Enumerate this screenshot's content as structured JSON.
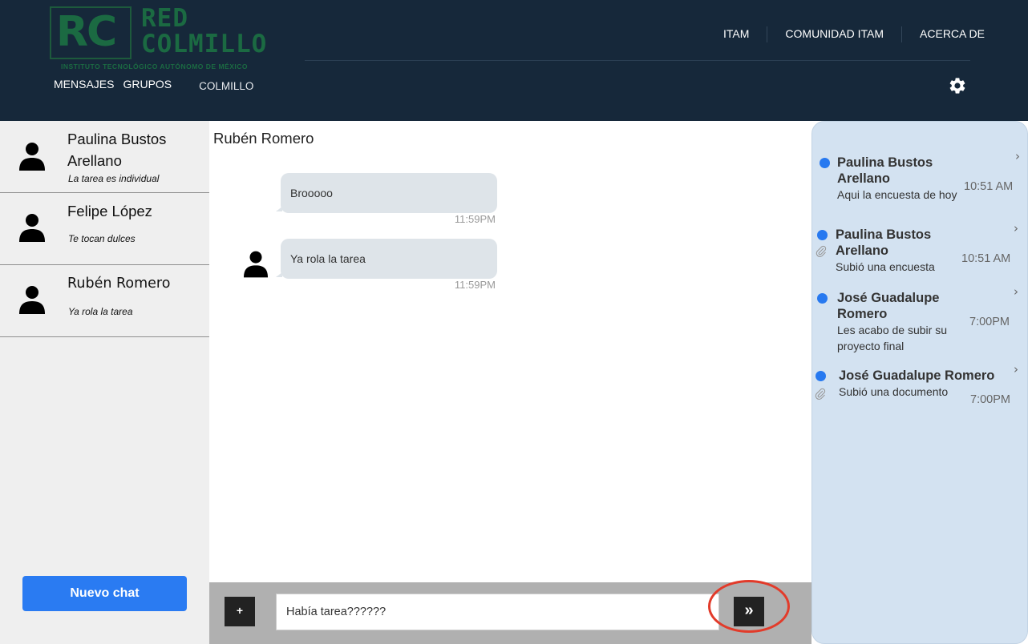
{
  "logo": {
    "rc": "RC",
    "line1": "RED",
    "line2": "COLMILLO",
    "institution": "INSTITUTO TECNOLÓGICO AUTÓNOMO DE MÉXICO",
    "color": "#1b6a42"
  },
  "topnav": {
    "items": [
      "ITAM",
      "COMUNIDAD ITAM",
      "ACERCA DE"
    ]
  },
  "subnav": {
    "mensajes": "MENSAJES",
    "grupos": "GRUPOS",
    "colmillo": "COLMILLO"
  },
  "settings_icon": "gear-icon",
  "sidebar": {
    "chats": [
      {
        "name": "Paulina Bustos Arellano",
        "preview": "La tarea es individual"
      },
      {
        "name": "Felipe López",
        "preview": "Te tocan dulces"
      },
      {
        "name": "Rubén Romero",
        "preview": "Ya rola la tarea"
      }
    ],
    "new_chat_label": "Nuevo chat"
  },
  "chat": {
    "title": "Rubén Romero",
    "messages": [
      {
        "text": "Brooooo",
        "time": "11:59PM"
      },
      {
        "text": "Ya rola la tarea",
        "time": "11:59PM"
      }
    ]
  },
  "composer": {
    "attach_label": "+",
    "input_value": "Había tarea??????",
    "send_label": "»"
  },
  "notifications": [
    {
      "name": "Paulina Bustos Arellano",
      "text": "Aqui la encuesta de hoy",
      "time": "10:51 AM"
    },
    {
      "name": "Paulina Bustos Arellano",
      "text": "Subió una encuesta",
      "time": "10:51 AM"
    },
    {
      "name": "José Guadalupe Romero",
      "text": "Les acabo de subir su proyecto final",
      "time": "7:00PM"
    },
    {
      "name": "José Guadalupe Romero",
      "text": "Subió una documento",
      "time": "7:00PM"
    }
  ],
  "colors": {
    "header": "#16283a",
    "accent": "#2a7bf2",
    "notif_panel": "#d3e2f1",
    "bubble": "#dee4e9",
    "highlight": "#e23b2a"
  }
}
